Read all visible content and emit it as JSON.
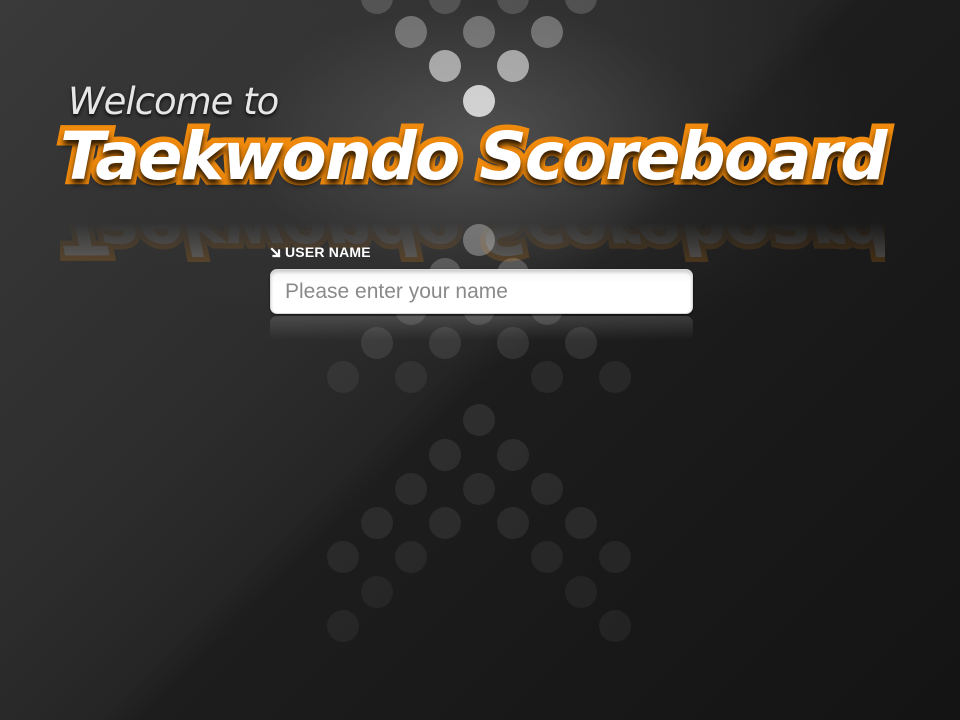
{
  "welcome": {
    "line1": "Welcome to",
    "title": "Taekwondo Scoreboard"
  },
  "login": {
    "label": "USER NAME",
    "label_icon": "arrow-down-right-icon",
    "placeholder": "Please enter your name",
    "value": ""
  },
  "colors": {
    "accent": "#f08a0c",
    "background": "#2a2a2a",
    "title_fill": "#ffffff"
  }
}
